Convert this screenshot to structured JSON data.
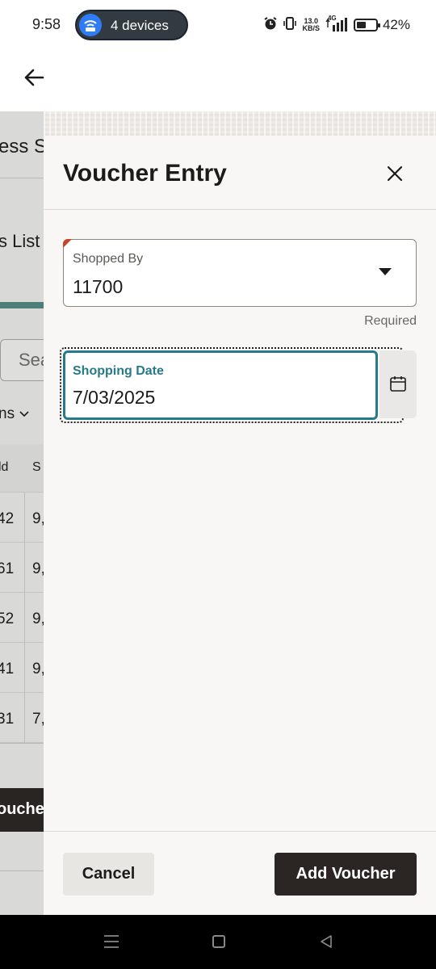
{
  "status_bar": {
    "time": "9:58",
    "hotspot_label": "4 devices",
    "net_speed_value": "13.0",
    "net_speed_unit": "KB/S",
    "network_type": "4G",
    "battery": "42%"
  },
  "background_page": {
    "title_fragment": "ess S",
    "list_fragment": "s List",
    "search_placeholder_fragment": "Sea",
    "columns_fragment": "ns",
    "header_col1": "ld",
    "header_col2": "S",
    "rows": [
      {
        "c1": "42",
        "c2": "9,"
      },
      {
        "c1": "61",
        "c2": "9,"
      },
      {
        "c1": "52",
        "c2": "9,"
      },
      {
        "c1": "41",
        "c2": "9,"
      },
      {
        "c1": "31",
        "c2": "7,"
      }
    ],
    "button_fragment": "ouche"
  },
  "dialog": {
    "title": "Voucher Entry",
    "shopped_by": {
      "label": "Shopped By",
      "value": "11700",
      "helper": "Required"
    },
    "shopping_date": {
      "label": "Shopping Date",
      "value": "7/03/2025"
    },
    "cancel_label": "Cancel",
    "add_label": "Add Voucher"
  },
  "colors": {
    "accent_teal": "#277a8a",
    "required_marker": "#c3462a",
    "primary_button": "#2b2623",
    "hotspot_blue": "#2f7cf6"
  },
  "icons": {
    "back": "arrow-left-icon",
    "close": "close-icon",
    "dropdown": "caret-down-icon",
    "calendar": "calendar-icon",
    "alarm": "alarm-icon",
    "vibrate": "vibrate-icon",
    "signal": "signal-icon",
    "battery": "battery-icon",
    "wifi": "wifi-hotspot-icon"
  }
}
